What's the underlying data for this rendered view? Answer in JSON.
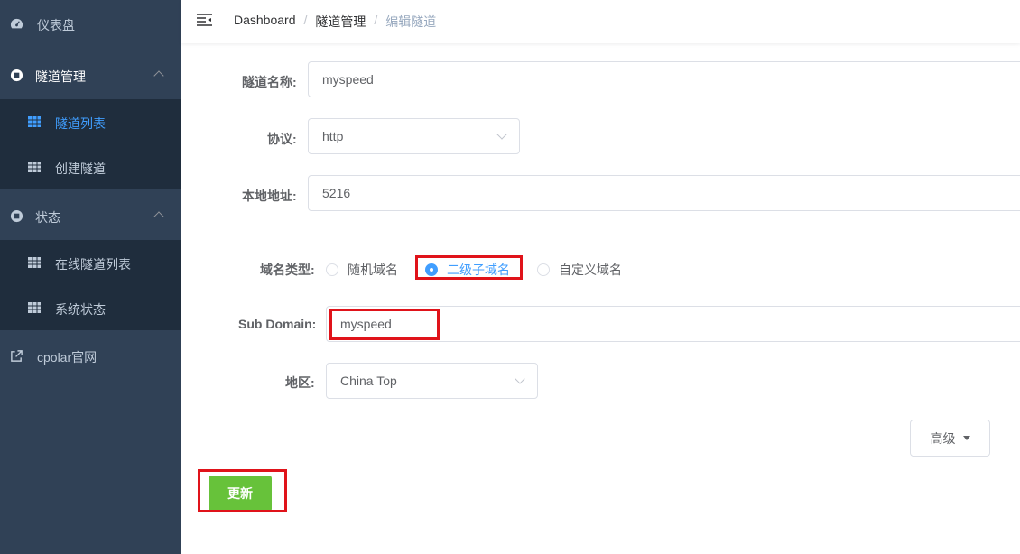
{
  "sidebar": {
    "dashboard": "仪表盘",
    "tunnel_mgmt": "隧道管理",
    "tunnel_list": "隧道列表",
    "create_tunnel": "创建隧道",
    "status": "状态",
    "online_tunnels": "在线隧道列表",
    "system_status": "系统状态",
    "cpolar_site": "cpolar官网"
  },
  "breadcrumb": {
    "home": "Dashboard",
    "section": "隧道管理",
    "current": "编辑隧道",
    "separator": "/"
  },
  "form": {
    "name_label": "隧道名称:",
    "name_value": "myspeed",
    "protocol_label": "协议:",
    "protocol_value": "http",
    "local_label": "本地地址:",
    "local_value": "5216",
    "domain_type_label": "域名类型:",
    "domain_options": [
      "随机域名",
      "二级子域名",
      "自定义域名"
    ],
    "domain_selected": "二级子域名",
    "subdomain_label": "Sub Domain:",
    "subdomain_value": "myspeed",
    "region_label": "地区:",
    "region_value": "China Top",
    "advanced_button": "高级",
    "update_button": "更新"
  },
  "colors": {
    "sidebar_bg": "#304156",
    "submenu_bg": "#1f2d3d",
    "active": "#409eff",
    "highlight": "#e0131a",
    "update_button": "#67c23a"
  }
}
